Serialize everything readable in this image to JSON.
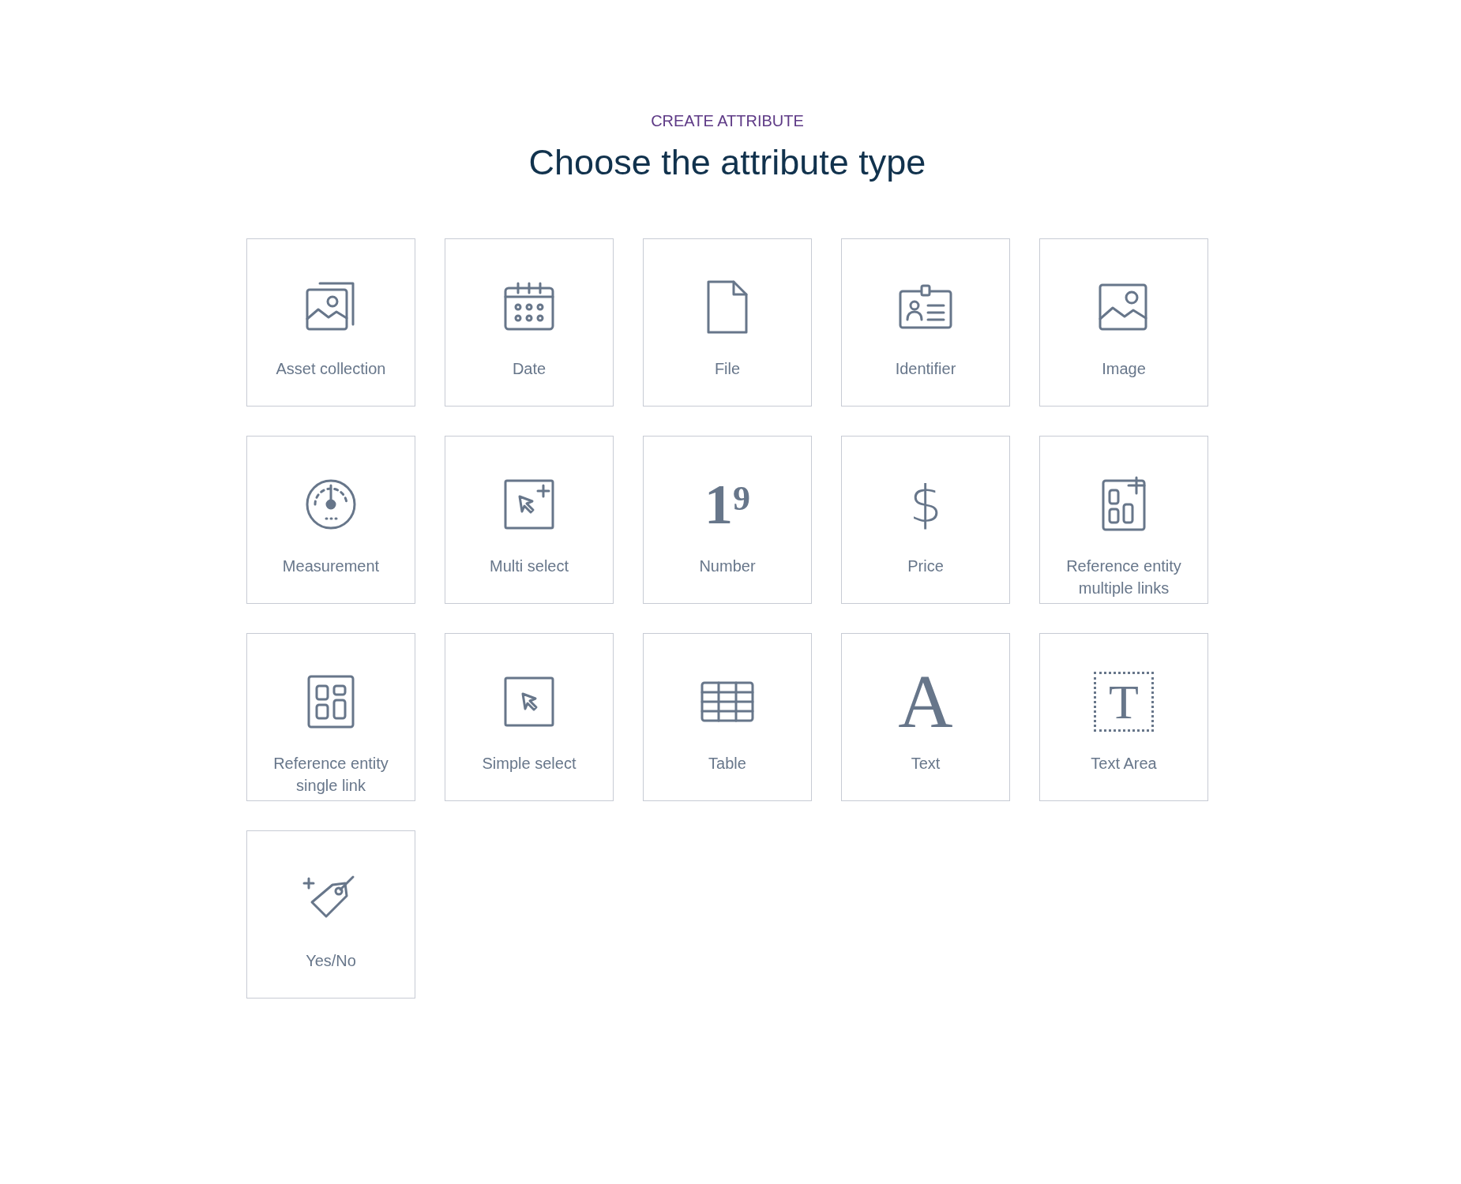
{
  "header": {
    "eyebrow": "CREATE ATTRIBUTE",
    "title": "Choose the attribute type"
  },
  "types": [
    {
      "label": "Asset collection",
      "kind": "assets"
    },
    {
      "label": "Date",
      "kind": "date"
    },
    {
      "label": "File",
      "kind": "file"
    },
    {
      "label": "Identifier",
      "kind": "identifier"
    },
    {
      "label": "Image",
      "kind": "image"
    },
    {
      "label": "Measurement",
      "kind": "measurement"
    },
    {
      "label": "Multi select",
      "kind": "multiselect"
    },
    {
      "label": "Number",
      "kind": "number",
      "glyphs": [
        "1",
        "9"
      ]
    },
    {
      "label": "Price",
      "kind": "price",
      "glyphs": [
        "$"
      ]
    },
    {
      "label": "Reference entity multiple links",
      "kind": "refmulti"
    },
    {
      "label": "Reference entity single link",
      "kind": "refsingle"
    },
    {
      "label": "Simple select",
      "kind": "select"
    },
    {
      "label": "Table",
      "kind": "table"
    },
    {
      "label": "Text",
      "kind": "text",
      "glyphs": [
        "A"
      ]
    },
    {
      "label": "Text Area",
      "kind": "textarea",
      "glyphs": [
        "T"
      ]
    },
    {
      "label": "Yes/No",
      "kind": "yesno"
    }
  ]
}
